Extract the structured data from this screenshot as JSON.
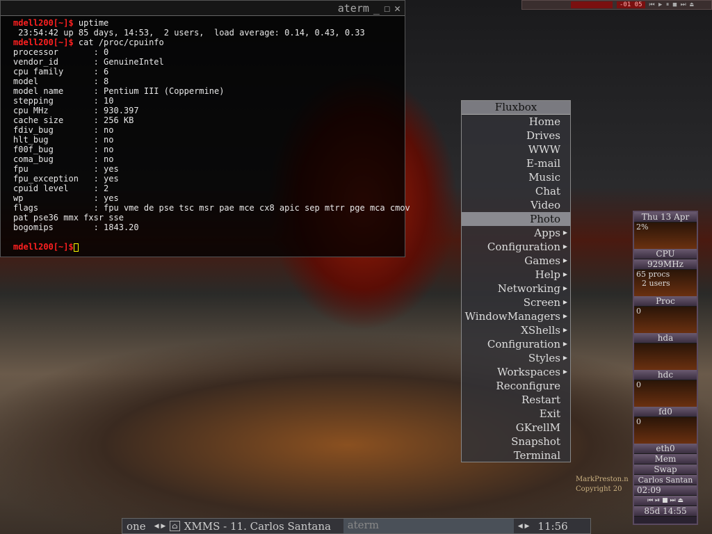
{
  "terminal": {
    "title": "aterm",
    "prompt": "mdell200[~]$",
    "lines": [
      {
        "type": "cmd",
        "text": " uptime"
      },
      {
        "type": "out",
        "text": " 23:54:42 up 85 days, 14:53,  2 users,  load average: 0.14, 0.43, 0.33"
      },
      {
        "type": "cmd",
        "text": " cat /proc/cpuinfo"
      },
      {
        "type": "out",
        "text": "processor       : 0"
      },
      {
        "type": "out",
        "text": "vendor_id       : GenuineIntel"
      },
      {
        "type": "out",
        "text": "cpu family      : 6"
      },
      {
        "type": "out",
        "text": "model           : 8"
      },
      {
        "type": "out",
        "text": "model name      : Pentium III (Coppermine)"
      },
      {
        "type": "out",
        "text": "stepping        : 10"
      },
      {
        "type": "out",
        "text": "cpu MHz         : 930.397"
      },
      {
        "type": "out",
        "text": "cache size      : 256 KB"
      },
      {
        "type": "out",
        "text": "fdiv_bug        : no"
      },
      {
        "type": "out",
        "text": "hlt_bug         : no"
      },
      {
        "type": "out",
        "text": "f00f_bug        : no"
      },
      {
        "type": "out",
        "text": "coma_bug        : no"
      },
      {
        "type": "out",
        "text": "fpu             : yes"
      },
      {
        "type": "out",
        "text": "fpu_exception   : yes"
      },
      {
        "type": "out",
        "text": "cpuid level     : 2"
      },
      {
        "type": "out",
        "text": "wp              : yes"
      },
      {
        "type": "out",
        "text": "flags           : fpu vme de pse tsc msr pae mce cx8 apic sep mtrr pge mca cmov"
      },
      {
        "type": "out",
        "text": "pat pse36 mmx fxsr sse"
      },
      {
        "type": "out",
        "text": "bogomips        : 1843.20"
      },
      {
        "type": "out",
        "text": " "
      }
    ]
  },
  "menu": {
    "title": "Fluxbox",
    "items": [
      {
        "label": "Home",
        "sub": false
      },
      {
        "label": "Drives",
        "sub": false
      },
      {
        "label": "WWW",
        "sub": false
      },
      {
        "label": "E-mail",
        "sub": false
      },
      {
        "label": "Music",
        "sub": false
      },
      {
        "label": "Chat",
        "sub": false
      },
      {
        "label": "Video",
        "sub": false
      },
      {
        "label": "Photo",
        "sub": false,
        "selected": true
      },
      {
        "label": "Apps",
        "sub": true
      },
      {
        "label": "Configuration",
        "sub": true
      },
      {
        "label": "Games",
        "sub": true
      },
      {
        "label": "Help",
        "sub": true
      },
      {
        "label": "Networking",
        "sub": true
      },
      {
        "label": "Screen",
        "sub": true
      },
      {
        "label": "WindowManagers",
        "sub": true
      },
      {
        "label": "XShells",
        "sub": true
      },
      {
        "label": "Configuration",
        "sub": true
      },
      {
        "label": "Styles",
        "sub": true
      },
      {
        "label": "Workspaces",
        "sub": true
      },
      {
        "label": "Reconfigure",
        "sub": false
      },
      {
        "label": "Restart",
        "sub": false
      },
      {
        "label": "Exit",
        "sub": false
      },
      {
        "label": "GKrellM",
        "sub": false
      },
      {
        "label": "Snapshot",
        "sub": false
      },
      {
        "label": "Terminal",
        "sub": false
      }
    ]
  },
  "gkrellm": {
    "date": "Thu 13 Apr",
    "cpu_pct": "2%",
    "cpu_label": "CPU",
    "mhz": "929MHz",
    "procs": "65 procs",
    "users": "2 users",
    "proc_label": "Proc",
    "proc_val": "0",
    "hda": "hda",
    "hdc_val": "0",
    "hdc": "hdc",
    "fd_val": "0",
    "fd0": "fd0",
    "eth_val": "0",
    "eth0": "eth0",
    "mem": "Mem",
    "swap": "Swap",
    "song": "Carlos Santan",
    "time": "02:09",
    "uptime": "85d 14:55"
  },
  "taskbar": {
    "workspace": "one",
    "tasks": [
      {
        "label": "XMMS - 11. Carlos Santana",
        "active": true
      },
      {
        "label": "aterm",
        "active": false
      }
    ],
    "clock": "11:56"
  },
  "dock": {
    "time": "-01 05"
  },
  "watermark": {
    "line1": "MarkPreston.n",
    "line2": "Copyright 20"
  }
}
